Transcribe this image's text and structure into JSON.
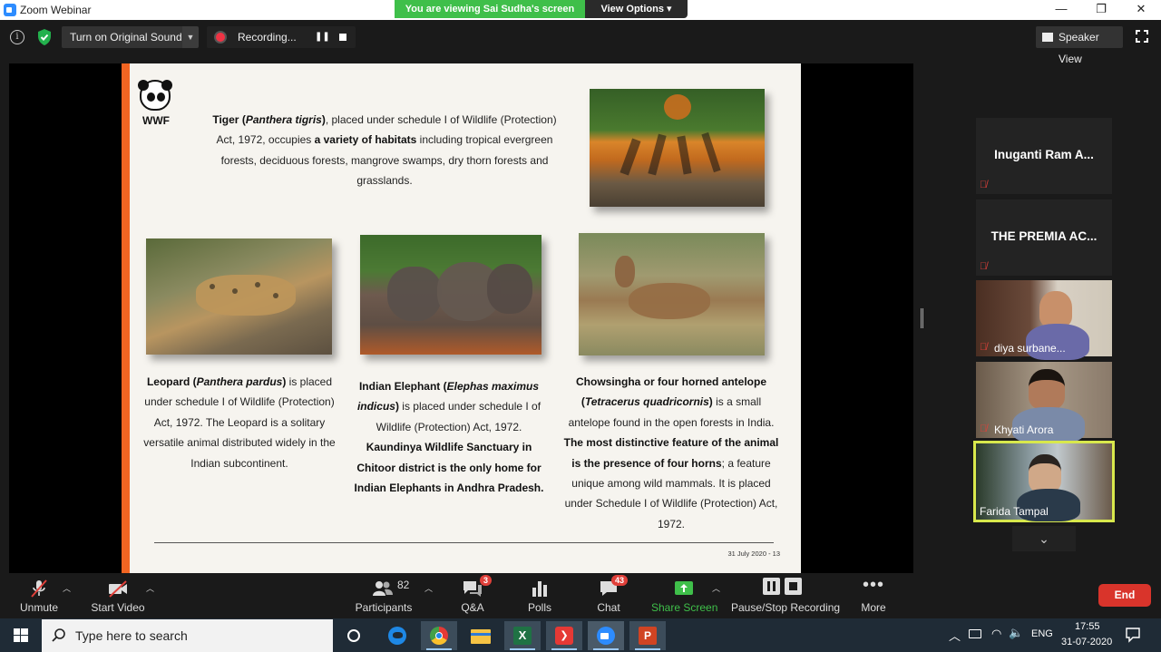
{
  "window": {
    "title": "Zoom Webinar",
    "minimize": "—",
    "maximize": "❐",
    "close": "✕"
  },
  "banner": {
    "viewing": "You are viewing Sai Sudha's screen",
    "view_options": "View Options ▾"
  },
  "topbar": {
    "info_icon": "i",
    "original_sound": "Turn on Original Sound",
    "recording": "Recording...",
    "speaker_view": "Speaker View"
  },
  "slide": {
    "logo_text": "WWF",
    "tiger_text_html": "<b>Tiger (<i>Panthera tigris</i>)</b>, placed under schedule I of Wildlife (Protection) Act, 1972, occupies <b>a variety of habitats</b> including tropical evergreen forests, deciduous forests, mangrove swamps, dry thorn forests and grasslands.",
    "leopard_text_html": "<b>Leopard (<i>Panthera pardus</i>)</b> is placed under schedule I of  Wildlife (Protection) Act, 1972.  The Leopard is a solitary versatile animal distributed widely in the Indian subcontinent.",
    "elephant_text_html": "<b>Indian Elephant (<i>Elephas maximus indicus</i>)</b> is placed under schedule I of Wildlife (Protection) Act, 1972. <b>Kaundinya Wildlife Sanctuary in Chitoor district is the only home for Indian Elephants in Andhra Pradesh.</b>",
    "chow_text_html": "<b>Chowsingha or four horned antelope (<i>Tetracerus quadricornis</i>)</b> is a small antelope found in the open forests in India. <b>The most distinctive feature of the animal is the presence of four horns</b>; a feature unique among wild mammals. It is placed under Schedule I of  Wildlife (Protection) Act, 1972.",
    "footer": "31 July 2020  -  13"
  },
  "participants": [
    {
      "name": "Inuganti Ram A...",
      "video": false,
      "muted": true
    },
    {
      "name": "THE PREMIA AC...",
      "video": false,
      "muted": true
    },
    {
      "name": "diya surbane...",
      "video": true,
      "muted": true
    },
    {
      "name": "Khyati Arora",
      "video": true,
      "muted": true
    },
    {
      "name": "Farida Tampal",
      "video": true,
      "muted": false,
      "active_speaker": true
    }
  ],
  "toolbar": {
    "unmute": "Unmute",
    "start_video": "Start Video",
    "participants_count": "82",
    "participants": "Participants",
    "qa_badge": "3",
    "qa": "Q&A",
    "polls": "Polls",
    "chat_badge": "43",
    "chat": "Chat",
    "share_screen": "Share Screen",
    "pause_stop": "Pause/Stop Recording",
    "more": "More",
    "end": "End",
    "share_color": "#3fbf4a",
    "end_color": "#d9342b"
  },
  "taskbar": {
    "search_placeholder": "Type here to search",
    "language": "ENG",
    "time": "17:55",
    "date": "31-07-2020"
  }
}
